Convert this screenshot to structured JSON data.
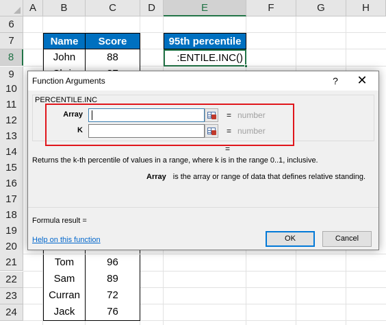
{
  "sheet": {
    "columns": [
      "A",
      "B",
      "C",
      "D",
      "E",
      "F",
      "G",
      "H"
    ],
    "selected_column": "E",
    "rows": [
      "6",
      "7",
      "8",
      "9",
      "10",
      "11",
      "12",
      "13",
      "14",
      "15",
      "16",
      "17",
      "18",
      "19",
      "20",
      "21",
      "22",
      "23",
      "24"
    ],
    "selected_row": "8",
    "table": {
      "header_name": "Name",
      "header_score": "Score",
      "visible_top_rows": [
        {
          "name": "John",
          "score": "88"
        },
        {
          "name": "Chris",
          "score": "87"
        }
      ],
      "visible_bottom_rows": [
        {
          "name": "Tom",
          "score": "96"
        },
        {
          "name": "Sam",
          "score": "89"
        },
        {
          "name": "Curran",
          "score": "72"
        },
        {
          "name": "Jack",
          "score": "76"
        }
      ]
    },
    "percentile_header": "95th percentile",
    "active_cell_text": ":ENTILE.INC()"
  },
  "dialog": {
    "title": "Function Arguments",
    "help_glyph": "?",
    "close_glyph": "✕",
    "function_name": "PERCENTILE.INC",
    "args": [
      {
        "label": "Array",
        "value": "",
        "equals": "=",
        "hint": "number"
      },
      {
        "label": "K",
        "value": "",
        "equals": "=",
        "hint": "number"
      }
    ],
    "result_equals": "=",
    "description": "Returns the k-th percentile of values in a range, where k is in the range 0..1, inclusive.",
    "arg_description_name": "Array",
    "arg_description_text": "is the array or range of data that defines relative standing.",
    "formula_result_label": "Formula result =",
    "help_link": "Help on this function",
    "ok_label": "OK",
    "cancel_label": "Cancel"
  },
  "colors": {
    "table_header_bg": "#0070c0",
    "excel_green": "#217346",
    "highlight_red": "#e0151b",
    "link_blue": "#0066cc"
  }
}
